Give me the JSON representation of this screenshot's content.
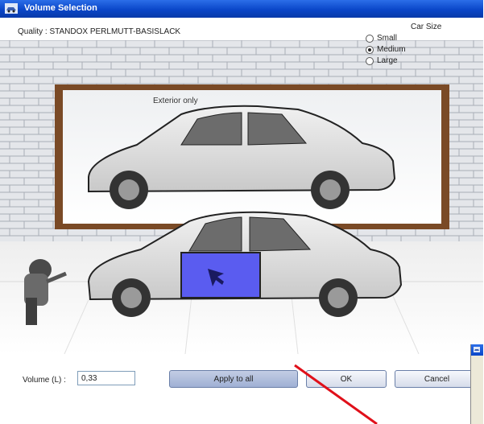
{
  "window": {
    "title": "Volume Selection",
    "icon": "car-window-icon"
  },
  "quality": {
    "text": "Quality : STANDOX PERLMUTT-BASISLACK"
  },
  "car_size": {
    "legend": "Car Size",
    "options": [
      {
        "label": "Small",
        "selected": false
      },
      {
        "label": "Medium",
        "selected": true
      },
      {
        "label": "Large",
        "selected": false
      }
    ]
  },
  "scene": {
    "exterior_label": "Exterior only",
    "highlight_color": "#5a5cf0"
  },
  "volume": {
    "label": "Volume (L) :",
    "value": "0,33"
  },
  "buttons": {
    "apply_all": "Apply to all",
    "ok": "OK",
    "cancel": "Cancel"
  },
  "colors": {
    "titlebar": "#0a46c8",
    "annotation_line": "#e0101a",
    "frame": "#7a4a26"
  }
}
